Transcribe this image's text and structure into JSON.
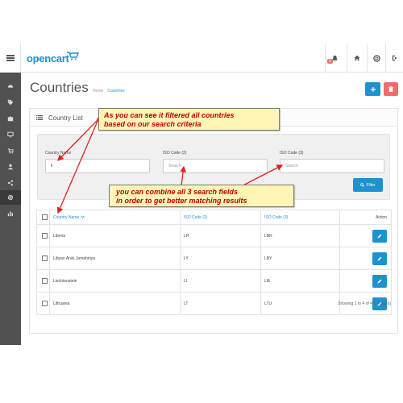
{
  "header": {
    "logo_text": "opencart",
    "notification_count": "5"
  },
  "page": {
    "title": "Countries",
    "breadcrumb": [
      "Home",
      "Countries"
    ]
  },
  "panel": {
    "title": "Country List"
  },
  "filters": {
    "country_name": {
      "label": "Country Name",
      "value": "li"
    },
    "iso_code_2": {
      "label": "ISO Code (2)",
      "placeholder": "Search"
    },
    "iso_code_3": {
      "label": "ISO Code (3)",
      "placeholder": "Search"
    },
    "filter_button": "Filter"
  },
  "table": {
    "headers": {
      "country_name": "Country Name",
      "iso_code_2": "ISO Code (2)",
      "iso_code_3": "ISO Code (3)",
      "action": "Action"
    },
    "rows": [
      {
        "name": "Liberia",
        "iso2": "LR",
        "iso3": "LBR"
      },
      {
        "name": "Libyan Arab Jamahiriya",
        "iso2": "LY",
        "iso3": "LBY"
      },
      {
        "name": "Liechtenstein",
        "iso2": "LI",
        "iso3": "LIE"
      },
      {
        "name": "Lithuania",
        "iso2": "LT",
        "iso3": "LTU"
      }
    ],
    "results_text": "Showing 1 to 4 of 4 (1 Pages)"
  },
  "annotations": {
    "callout_1": [
      "As you can see it filtered all countries",
      "based on our search criteria"
    ],
    "callout_2": [
      "you can combine all 3 search fields",
      "in order to get better matching results"
    ]
  },
  "colors": {
    "primary": "#1e91cf",
    "danger": "#f56b6b",
    "sidebar": "#515151",
    "callout_bg": "#fff5b4",
    "callout_text": "#c00000",
    "arrow": "#e02020"
  },
  "icons": [
    "menu-icon",
    "bell-icon",
    "home-icon",
    "life-ring-icon",
    "sign-out-icon",
    "dashboard-icon",
    "tag-icon",
    "puzzle-icon",
    "desktop-icon",
    "user-icon",
    "share-icon",
    "cog-icon",
    "bar-chart-icon",
    "list-icon",
    "plus-icon",
    "trash-icon",
    "search-icon",
    "pencil-icon",
    "caret-down-icon"
  ]
}
